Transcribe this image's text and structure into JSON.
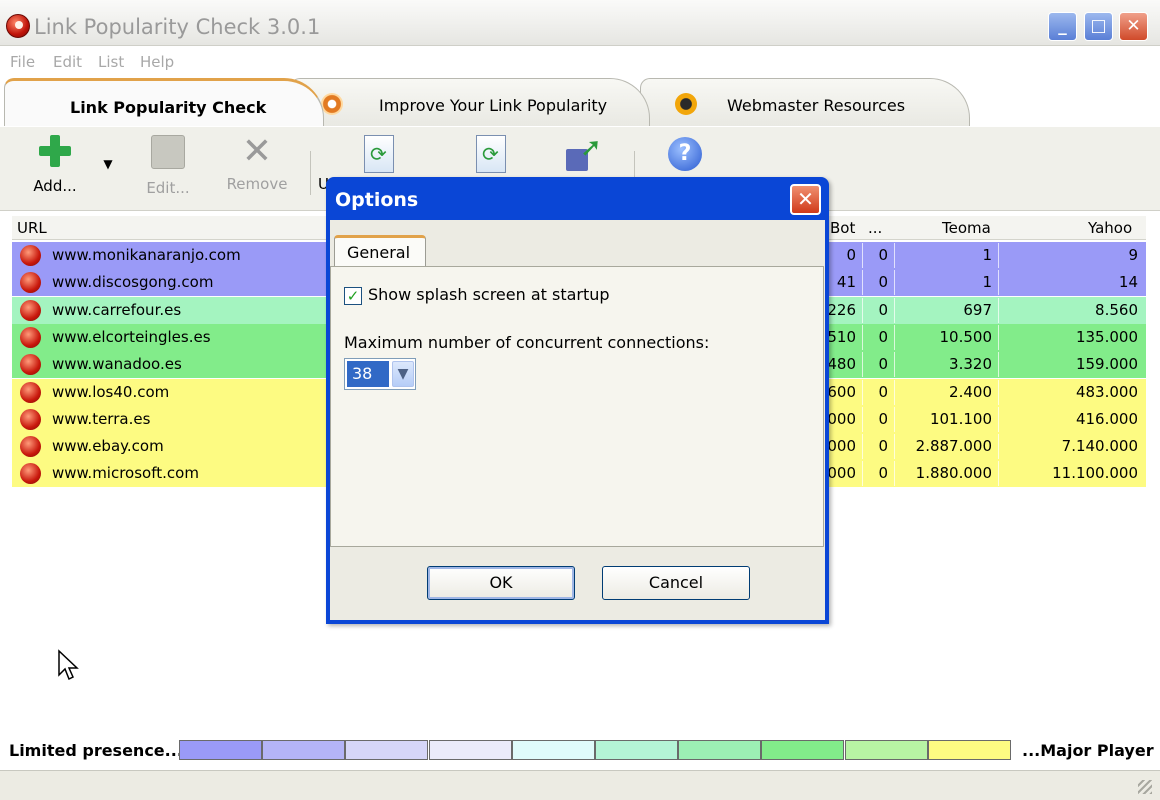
{
  "window": {
    "title": "Link Popularity Check 3.0.1"
  },
  "menu": [
    "File",
    "Edit",
    "List",
    "Help"
  ],
  "tabs": [
    {
      "label": "Link Popularity Check",
      "active": true
    },
    {
      "label": "Improve Your Link Popularity",
      "active": false
    },
    {
      "label": "Webmaster Resources",
      "active": false
    }
  ],
  "toolbar": {
    "add": "Add...",
    "edit": "Edit...",
    "remove": "Remove",
    "hidden_label": "U"
  },
  "table": {
    "headers": {
      "url": "URL",
      "bot": "Bot",
      "dots": "...",
      "teoma": "Teoma",
      "yahoo": "Yahoo"
    },
    "rows": [
      {
        "url": "www.monikanaranjo.com",
        "bot": "0",
        "dots": "0",
        "teoma": "1",
        "yahoo": "9",
        "color": "#9a9af7"
      },
      {
        "url": "www.discosgong.com",
        "bot": "41",
        "dots": "0",
        "teoma": "1",
        "yahoo": "14",
        "color": "#9a9af7"
      },
      {
        "url": "www.carrefour.es",
        "bot": "226",
        "dots": "0",
        "teoma": "697",
        "yahoo": "8.560",
        "color": "#a4f4c0"
      },
      {
        "url": "www.elcorteingles.es",
        "bot": "510",
        "dots": "0",
        "teoma": "10.500",
        "yahoo": "135.000",
        "color": "#82ec8a"
      },
      {
        "url": "www.wanadoo.es",
        "bot": "480",
        "dots": "0",
        "teoma": "3.320",
        "yahoo": "159.000",
        "color": "#82ec8a"
      },
      {
        "url": "www.los40.com",
        "bot": "600",
        "dots": "0",
        "teoma": "2.400",
        "yahoo": "483.000",
        "color": "#fdfb82"
      },
      {
        "url": "www.terra.es",
        "bot": "000",
        "dots": "0",
        "teoma": "101.100",
        "yahoo": "416.000",
        "color": "#fdfb82"
      },
      {
        "url": "www.ebay.com",
        "bot": "000",
        "dots": "0",
        "teoma": "2.887.000",
        "yahoo": "7.140.000",
        "color": "#fdfb82"
      },
      {
        "url": "www.microsoft.com",
        "bot": "000",
        "dots": "0",
        "teoma": "1.880.000",
        "yahoo": "11.100.000",
        "color": "#fdfb82"
      }
    ]
  },
  "dialog": {
    "title": "Options",
    "tab": "General",
    "show_splash_label": "Show splash screen at startup",
    "show_splash_checked": true,
    "max_connections_label": "Maximum number of concurrent connections:",
    "max_connections_value": "38",
    "ok": "OK",
    "cancel": "Cancel"
  },
  "legend": {
    "left": "Limited presence...",
    "right": "...Major Player",
    "colors": [
      "#9a9af7",
      "#b4b4f7",
      "#d6d6f8",
      "#ebebfa",
      "#e0fbfb",
      "#b4f4d6",
      "#9cf0b4",
      "#82ec8a",
      "#b8f4a4",
      "#fdfb82"
    ]
  }
}
